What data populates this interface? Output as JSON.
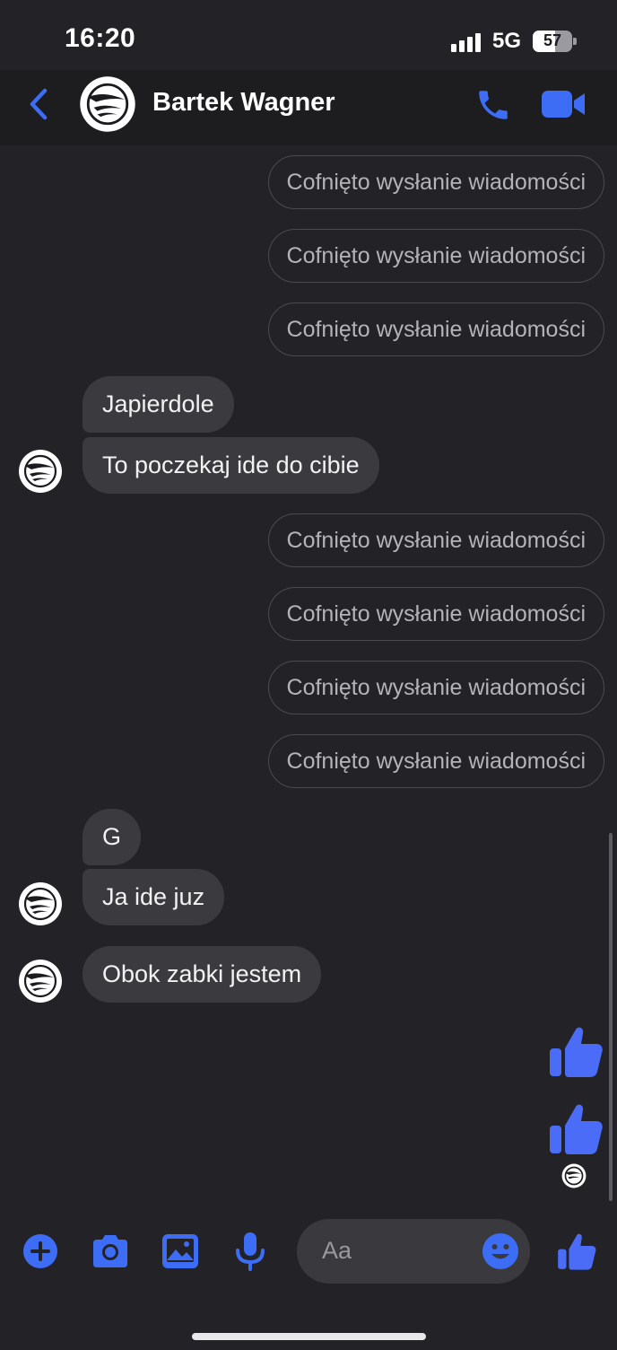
{
  "status_bar": {
    "time": "16:20",
    "network": "5G",
    "battery": "57",
    "battery_level": 0.57
  },
  "header": {
    "contact_name": "Bartek Wagner"
  },
  "unsent_label": "Cofnięto wysłanie wiadomości",
  "messages": {
    "m1": "Japierdole",
    "m2": "To poczekaj ide do cibie",
    "m3": "G",
    "m4": "Ja ide juz",
    "m5": "Obok zabki jestem"
  },
  "composer": {
    "placeholder": "Aa"
  },
  "colors": {
    "accent": "#3d6cf5",
    "background": "#232327",
    "bubble": "#3b3b3f"
  },
  "icons": [
    "back-chevron-icon",
    "phone-icon",
    "video-camera-icon",
    "plus-circle-icon",
    "camera-icon",
    "image-icon",
    "microphone-icon",
    "emoji-icon",
    "thumbs-up-icon"
  ]
}
